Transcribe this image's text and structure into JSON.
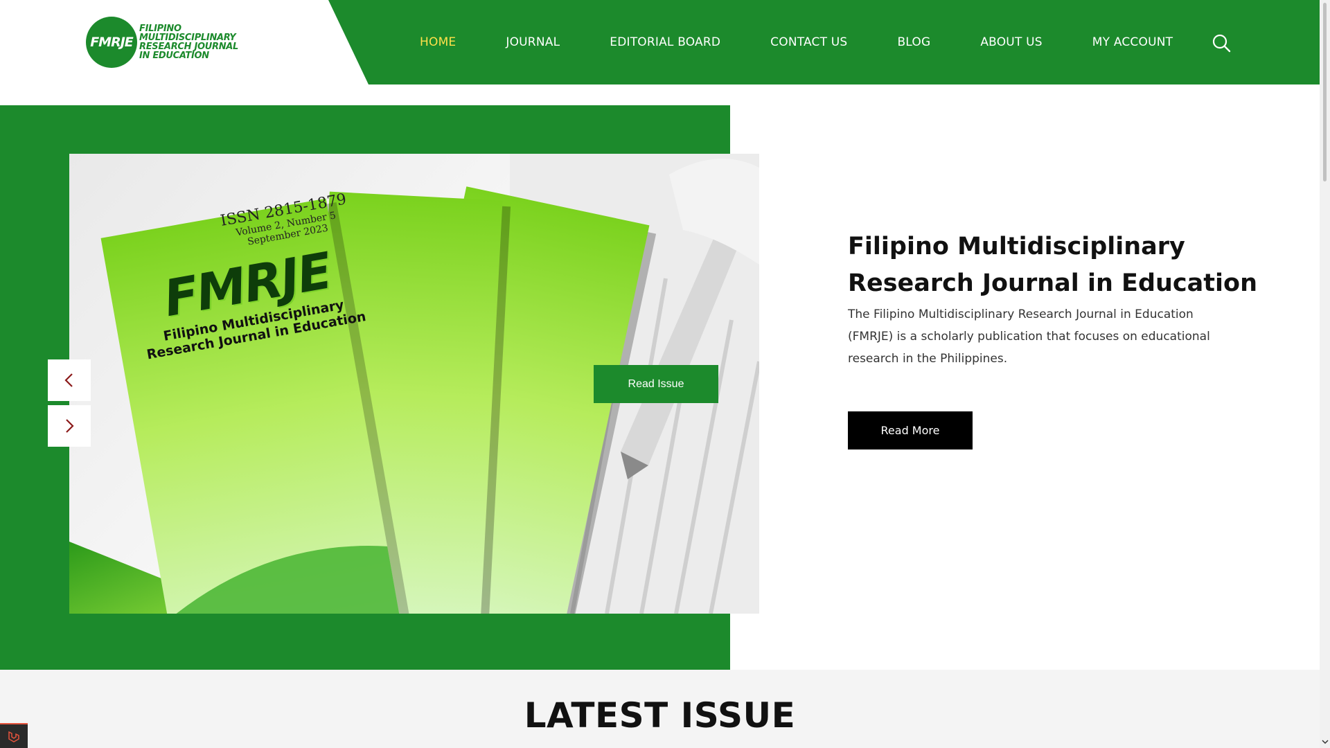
{
  "site": {
    "logo_abbrev": "FMRJE",
    "logo_lines": [
      "FILIPINO",
      "MULTIDISCIPLINARY",
      "RESEARCH JOURNAL",
      "IN EDUCATION"
    ],
    "brand_color": "#1c8a2c",
    "active_nav_color": "#ffe14a"
  },
  "nav": {
    "items": [
      {
        "label": "HOME",
        "active": true
      },
      {
        "label": "JOURNAL",
        "active": false
      },
      {
        "label": "EDITORIAL BOARD",
        "active": false
      },
      {
        "label": "CONTACT US",
        "active": false
      },
      {
        "label": "BLOG",
        "active": false
      },
      {
        "label": "ABOUT US",
        "active": false
      },
      {
        "label": "MY ACCOUNT",
        "active": false
      }
    ],
    "search_icon": "search-icon"
  },
  "slider": {
    "cover": {
      "issn": "ISSN 2815-1879",
      "volume": "Volume 2, Number 5",
      "date": "September 2023",
      "abbrev": "FMRJE",
      "title_line1": "Filipino Multidisciplinary",
      "title_line2": "Research Journal in Education"
    },
    "prev_icon": "chevron-left-icon",
    "next_icon": "chevron-right-icon",
    "read_issue_label": "Read Issue"
  },
  "hero": {
    "title": "Filipino Multidisciplinary Research Journal in Education",
    "description": "The Filipino Multidisciplinary Research Journal in Education (FMRJE) is a scholarly publication that focuses on educational research in the Philippines.",
    "read_more_label": "Read More"
  },
  "latest": {
    "title": "LATEST ISSUE"
  }
}
